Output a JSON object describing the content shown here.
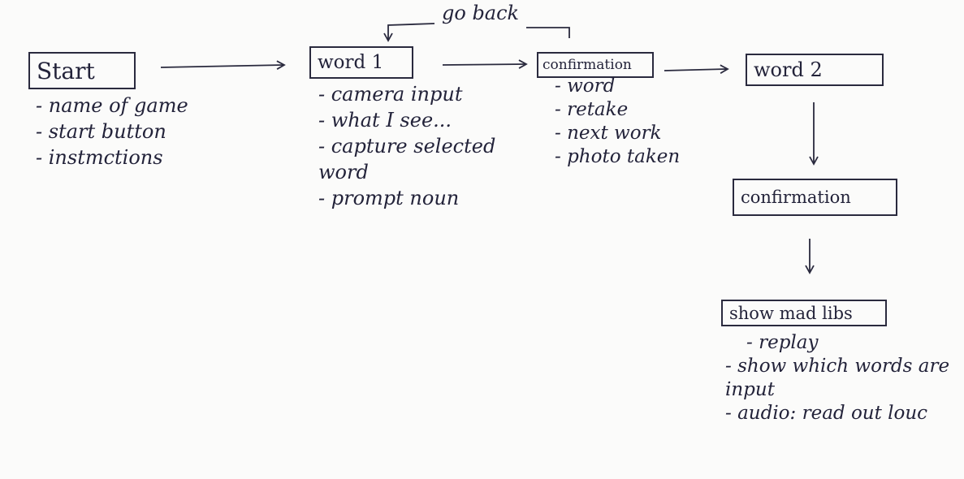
{
  "nodes": {
    "start": "Start",
    "word1": "word 1",
    "confirm1": "confirmation",
    "word2": "word 2",
    "confirm2": "confirmation",
    "madlibs": "show mad libs"
  },
  "edge_labels": {
    "go_back": "go back"
  },
  "notes": {
    "start": [
      "- name of game",
      "- start button",
      "- instmctions"
    ],
    "word1": [
      "- camera input",
      "- what I see...",
      "- capture selected word",
      "- prompt noun"
    ],
    "confirm1": [
      "- word",
      "- retake",
      "- next work",
      "- photo taken"
    ],
    "madlibs": [
      "- replay",
      "- show which words are input",
      "- audio: read out louc"
    ]
  },
  "colors": {
    "ink": "#23233a",
    "paper": "#fbfbfa"
  }
}
